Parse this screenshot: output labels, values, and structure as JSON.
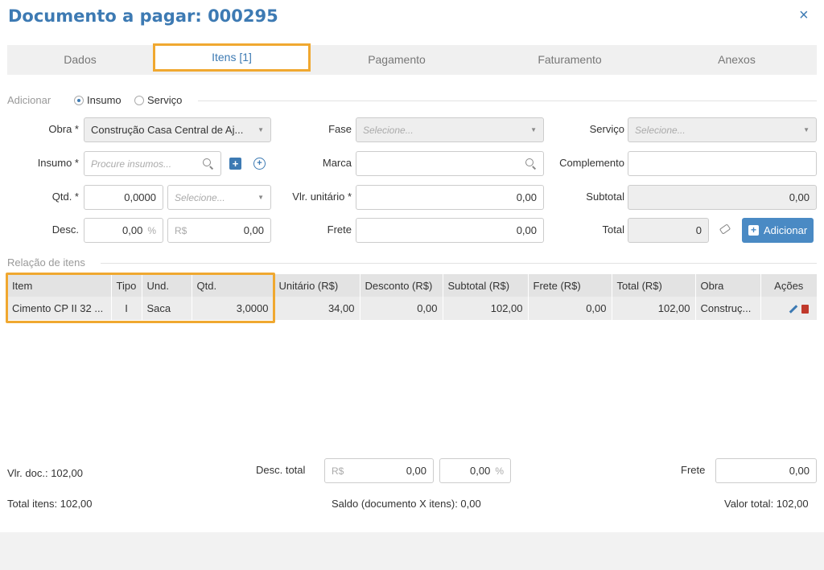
{
  "window": {
    "title": "Documento a pagar: 000295",
    "close_icon": "×"
  },
  "tabs": [
    "Dados",
    "Itens [1]",
    "Pagamento",
    "Faturamento",
    "Anexos"
  ],
  "add_section": {
    "label": "Adicionar",
    "option_insumo": "Insumo",
    "option_servico": "Serviço",
    "selected": "Insumo"
  },
  "form": {
    "obra_label": "Obra *",
    "obra_value": "Construção Casa Central de Aj...",
    "fase_label": "Fase",
    "fase_placeholder": "Selecione...",
    "servico_label": "Serviço",
    "servico_placeholder": "Selecione...",
    "insumo_label": "Insumo *",
    "insumo_placeholder": "Procure insumos...",
    "marca_label": "Marca",
    "marca_value": "",
    "complemento_label": "Complemento",
    "complemento_value": "",
    "qtd_label": "Qtd. *",
    "qtd_value": "0,0000",
    "unit_placeholder": "Selecione...",
    "vlr_unitario_label": "Vlr. unitário *",
    "vlr_unitario_value": "0,00",
    "subtotal_label": "Subtotal",
    "subtotal_value": "0,00",
    "desc_label": "Desc.",
    "desc_pct_value": "0,00",
    "desc_pct_suffix": "%",
    "desc_rs_prefix": "R$",
    "desc_rs_value": "0,00",
    "frete_label": "Frete",
    "frete_value": "0,00",
    "total_label": "Total",
    "total_value": "0",
    "add_button": "Adicionar"
  },
  "items_section": {
    "label": "Relação de itens",
    "columns": [
      "Item",
      "Tipo",
      "Und.",
      "Qtd.",
      "Unitário (R$)",
      "Desconto (R$)",
      "Subtotal (R$)",
      "Frete (R$)",
      "Total (R$)",
      "Obra",
      "Ações"
    ],
    "rows": [
      [
        "Cimento CP II 32 ...",
        "I",
        "Saca",
        "3,0000",
        "34,00",
        "0,00",
        "102,00",
        "0,00",
        "102,00",
        "Construç..."
      ]
    ]
  },
  "footer": {
    "vlr_doc": "Vlr. doc.: 102,00",
    "desc_total_label": "Desc. total",
    "desc_total_rs_prefix": "R$",
    "desc_total_rs_value": "0,00",
    "desc_total_pct_value": "0,00",
    "desc_total_pct_suffix": "%",
    "frete_label": "Frete",
    "frete_value": "0,00",
    "total_itens": "Total itens: 102,00",
    "saldo": "Saldo (documento X itens): 0,00",
    "valor_total": "Valor total: 102,00"
  },
  "colors": {
    "accent": "#3d7ab3",
    "highlight": "#f0a830",
    "delete": "#c0392b"
  }
}
